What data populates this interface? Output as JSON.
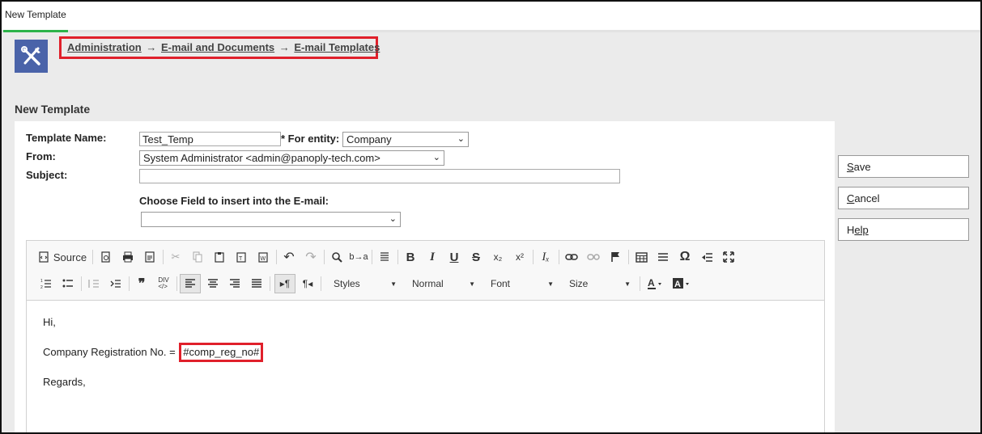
{
  "tab": {
    "label": "New Template"
  },
  "breadcrumb": {
    "items": [
      "Administration",
      "E-mail and Documents",
      "E-mail Templates"
    ],
    "separator": "→"
  },
  "page": {
    "title": "New Template"
  },
  "form": {
    "template_name_label": "Template Name:",
    "template_name_value": "Test_Temp",
    "entity_label": "* For entity:",
    "entity_value": "Company",
    "from_label": "From:",
    "from_value": "System Administrator <admin@panoply-tech.com>",
    "subject_label": "Subject:",
    "subject_value": "",
    "choose_field_label": "Choose Field to insert into the E-mail:",
    "choose_field_value": ""
  },
  "toolbar": {
    "source_label": "Source",
    "styles_label": "Styles",
    "format_label": "Normal",
    "font_label": "Font",
    "size_label": "Size",
    "omega": "Ω",
    "quote": "❞",
    "bold": "B",
    "italic": "I",
    "underline": "U",
    "strike": "S"
  },
  "editor": {
    "line1": "Hi,",
    "line2_prefix": "Company Registration No. = ",
    "token": "#comp_reg_no#",
    "line3": "Regards,"
  },
  "buttons": {
    "save_first": "S",
    "save_rest": "ave",
    "cancel_first": "C",
    "cancel_rest": "ancel",
    "help_first": "H",
    "help_rest": "elp"
  },
  "colors": {
    "accent_green": "#2db34a",
    "highlight_red": "#e0202b",
    "icon_blue": "#4a63a9"
  }
}
